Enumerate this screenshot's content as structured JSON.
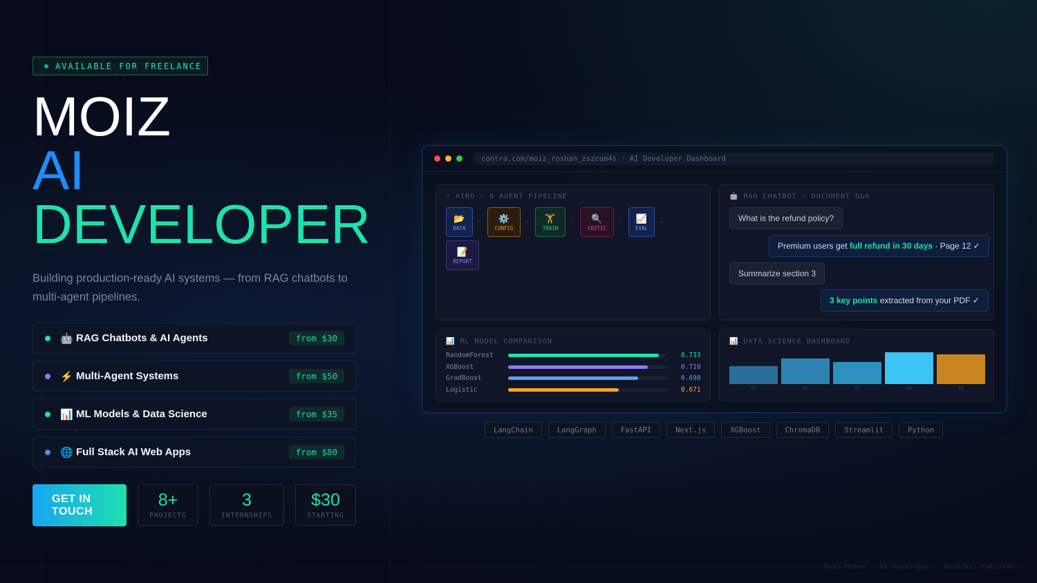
{
  "badge": {
    "text": "AVAILABLE FOR FREELANCE"
  },
  "hero": {
    "line1": "MOIZ",
    "line2": "AI",
    "line3": "DEVELOPER",
    "subtitle": "Building production-ready AI systems — from RAG chatbots to multi-agent pipelines."
  },
  "services": [
    {
      "icon": "🤖",
      "icon_name": "robot-icon",
      "name": "RAG Chatbots & AI Agents",
      "price": "from $30",
      "dot_color": "#1ee2a9"
    },
    {
      "icon": "⚡",
      "icon_name": "lightning-icon",
      "name": "Multi-Agent Systems",
      "price": "from $50",
      "dot_color": "#8b7cf6"
    },
    {
      "icon": "📊",
      "icon_name": "bar-chart-icon",
      "name": "ML Models & Data Science",
      "price": "from $35",
      "dot_color": "#1ee2a9"
    },
    {
      "icon": "🌐",
      "icon_name": "globe-icon",
      "name": "Full Stack AI Web Apps",
      "price": "from $80",
      "dot_color": "#4f8cf7"
    }
  ],
  "cta": {
    "label": "GET IN TOUCH"
  },
  "stats": [
    {
      "value": "8+",
      "label": "PROJECTS"
    },
    {
      "value": "3",
      "label": "INTERNSHIPS"
    },
    {
      "value": "$30",
      "label": "STARTING"
    }
  ],
  "window": {
    "url": "contra.com/moiz_roshan_zszcum4s · AI Developer Dashboard",
    "pipeline": {
      "title": "⚡ AIRO — 6 AGENT PIPELINE",
      "agents": [
        {
          "icon": "📂",
          "icon_name": "folder-icon",
          "label": "DATA",
          "color": "#4f8cf7"
        },
        {
          "icon": "⚙️",
          "icon_name": "gear-icon",
          "label": "CONFIG",
          "color": "#e0962a"
        },
        {
          "icon": "🏋",
          "icon_name": "weightlifter-icon",
          "label": "TRAIN",
          "color": "#1ecf8f"
        },
        {
          "icon": "🔍",
          "icon_name": "magnifier-icon",
          "label": "CRITIC",
          "color": "#e04a8a"
        },
        {
          "icon": "📈",
          "icon_name": "trend-chart-icon",
          "label": "EVAL",
          "color": "#4f8cf7"
        },
        {
          "icon": "📝",
          "icon_name": "memo-icon",
          "label": "REPORT",
          "color": "#8b7cf6"
        }
      ]
    },
    "rag": {
      "title": "🤖 RAG CHATBOT — DOCUMENT Q&A",
      "q1": "What is the refund policy?",
      "a1_pre": "Premium users get ",
      "a1_bold": "full refund in 30 days",
      "a1_post": " · Page 12 ✓",
      "q2": "Summarize section 3",
      "a2_bold": "3 key points",
      "a2_post": " extracted from your PDF ✓"
    },
    "ml": {
      "title": "📊 ML MODEL COMPARISON",
      "models": [
        {
          "name": "RandomForest",
          "value": "0.733",
          "fraction": 0.95,
          "color": "#1ee2a9"
        },
        {
          "name": "XGBoost",
          "value": "0.710",
          "fraction": 0.88,
          "color": "#8b7cf6"
        },
        {
          "name": "GradBoost",
          "value": "0.698",
          "fraction": 0.82,
          "color": "#5aa0f5"
        },
        {
          "name": "Logistic",
          "value": "0.671",
          "fraction": 0.7,
          "color": "#f5a623"
        }
      ]
    },
    "ds": {
      "title": "📊 DATA SCIENCE DASHBOARD",
      "bars": [
        {
          "label": "Q1",
          "fraction": 0.45,
          "color": "#2a6f9a"
        },
        {
          "label": "Q2",
          "fraction": 0.8,
          "color": "#2e83b3"
        },
        {
          "label": "Q3",
          "fraction": 0.68,
          "color": "#2e8fc0"
        },
        {
          "label": "Q4",
          "fraction": 1.0,
          "color": "#3cc4f4"
        },
        {
          "label": "Q5",
          "fraction": 0.95,
          "color": "#c98620"
        }
      ]
    }
  },
  "tags": [
    "LangChain",
    "LangGraph",
    "FastAPI",
    "Next.js",
    "XGBoost",
    "ChromaDB",
    "Streamlit",
    "Python"
  ],
  "footer": {
    "name": "Moiz Memon",
    "role": "AI Developer",
    "location": "Karachi, Pakistan"
  }
}
